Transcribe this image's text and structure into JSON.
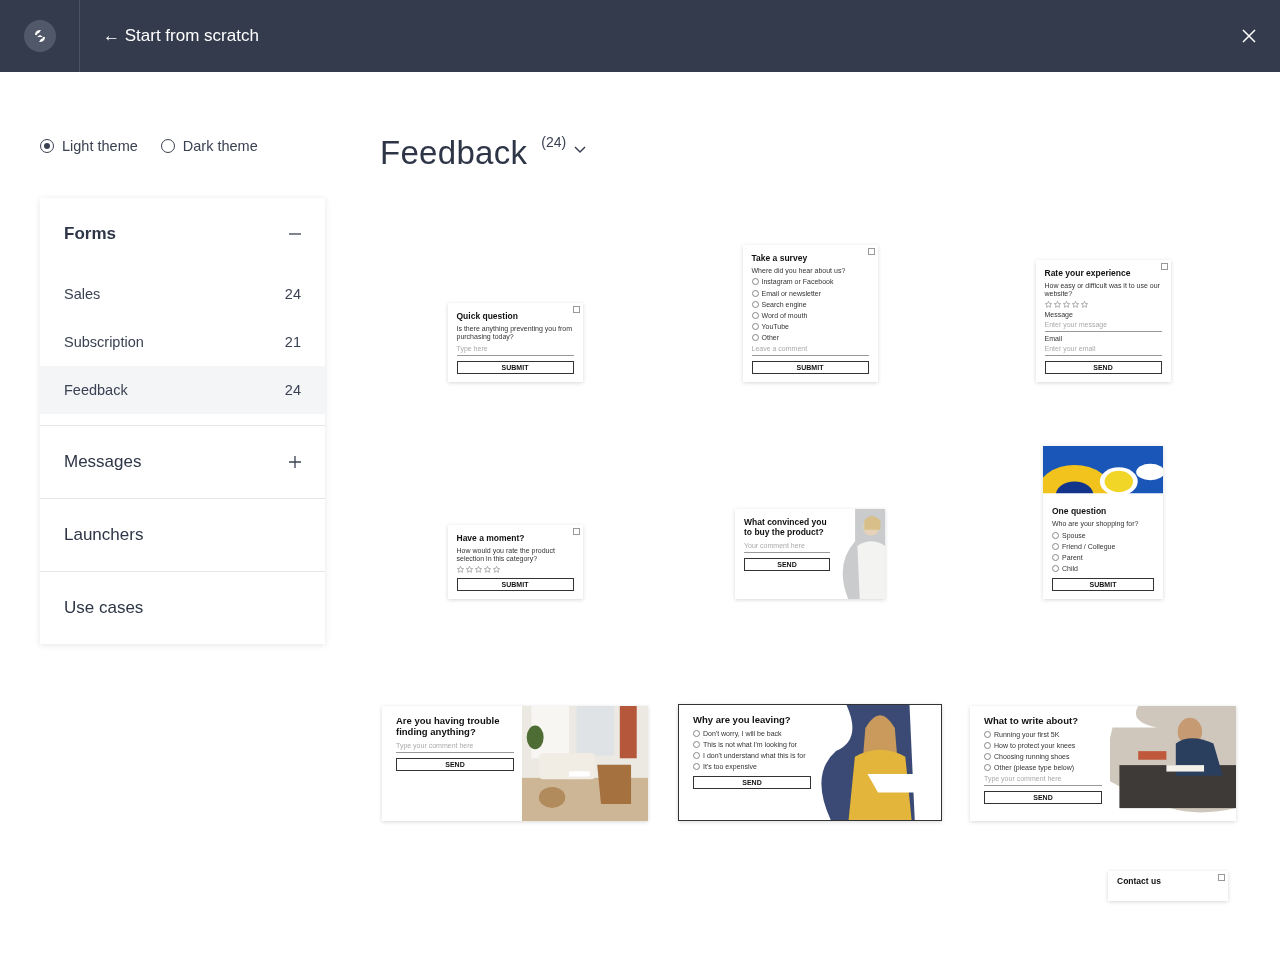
{
  "header": {
    "back_label": "← Start from scratch"
  },
  "themes": [
    {
      "label": "Light theme",
      "selected": true
    },
    {
      "label": "Dark theme",
      "selected": false
    }
  ],
  "sidebar": {
    "sections": [
      {
        "kind": "group",
        "title": "Forms",
        "expanded": true,
        "items": [
          {
            "label": "Sales",
            "count": "24",
            "selected": false
          },
          {
            "label": "Subscription",
            "count": "21",
            "selected": false
          },
          {
            "label": "Feedback",
            "count": "24",
            "selected": true
          }
        ]
      },
      {
        "kind": "group",
        "title": "Messages",
        "expanded": false
      },
      {
        "kind": "link",
        "title": "Launchers"
      },
      {
        "kind": "link",
        "title": "Use cases"
      }
    ]
  },
  "heading": {
    "title": "Feedback",
    "count": "(24)"
  },
  "templates": [
    {
      "kind": "plain",
      "blocks": [
        {
          "kind": "title",
          "text": "Quick question"
        },
        {
          "kind": "text",
          "text": "Is there anything preventing you from purchasing today?"
        },
        {
          "kind": "input",
          "placeholder": "Type here"
        },
        {
          "kind": "button",
          "text": "SUBMIT"
        }
      ]
    },
    {
      "kind": "plain",
      "blocks": [
        {
          "kind": "title",
          "text": "Take a survey"
        },
        {
          "kind": "text",
          "text": "Where did you hear about us?"
        },
        {
          "kind": "option",
          "text": "Instagram or Facebook"
        },
        {
          "kind": "option",
          "text": "Email or newsletter"
        },
        {
          "kind": "option",
          "text": "Search engine"
        },
        {
          "kind": "option",
          "text": "Word of mouth"
        },
        {
          "kind": "option",
          "text": "YouTube"
        },
        {
          "kind": "option",
          "text": "Other"
        },
        {
          "kind": "input",
          "placeholder": "Leave a comment"
        },
        {
          "kind": "button",
          "text": "SUBMIT"
        }
      ]
    },
    {
      "kind": "plain",
      "blocks": [
        {
          "kind": "title",
          "text": "Rate your experience"
        },
        {
          "kind": "text",
          "text": "How easy or difficult was it to use our website?"
        },
        {
          "kind": "rating",
          "stars": 0
        },
        {
          "kind": "label",
          "text": "Message"
        },
        {
          "kind": "input",
          "placeholder": "Enter your message"
        },
        {
          "kind": "label",
          "text": "Email"
        },
        {
          "kind": "input",
          "placeholder": "Enter your email"
        },
        {
          "kind": "button",
          "text": "SEND"
        }
      ]
    },
    {
      "kind": "plain",
      "blocks": [
        {
          "kind": "title",
          "text": "Have a moment?"
        },
        {
          "kind": "text",
          "text": "How would you rate the product selection in this category?"
        },
        {
          "kind": "rating",
          "stars": 0
        },
        {
          "kind": "button",
          "text": "SUBMIT"
        }
      ]
    },
    {
      "kind": "overlay",
      "blocks": [
        {
          "kind": "title",
          "text": "What convinced you to buy the product?"
        },
        {
          "kind": "input",
          "placeholder": "Your comment here"
        },
        {
          "kind": "button",
          "text": "SEND"
        }
      ]
    },
    {
      "kind": "banner",
      "blocks": [
        {
          "kind": "title",
          "text": "One question"
        },
        {
          "kind": "text",
          "text": "Who are your shopping for?"
        },
        {
          "kind": "option",
          "text": "Spouse"
        },
        {
          "kind": "option",
          "text": "Friend / Collegue"
        },
        {
          "kind": "option",
          "text": "Parent"
        },
        {
          "kind": "option",
          "text": "Child"
        },
        {
          "kind": "button",
          "text": "SUBMIT"
        }
      ]
    },
    {
      "kind": "side",
      "blocks": [
        {
          "kind": "title",
          "text": "Are you having trouble finding anything?"
        },
        {
          "kind": "input",
          "placeholder": "Type your comment here"
        },
        {
          "kind": "button",
          "text": "SEND"
        }
      ]
    },
    {
      "kind": "framed",
      "blocks": [
        {
          "kind": "title",
          "text": "Why are you leaving?"
        },
        {
          "kind": "option",
          "text": "Don't worry, I will be back"
        },
        {
          "kind": "option",
          "text": "This is not what I'm looking for"
        },
        {
          "kind": "option",
          "text": "I don't understand what this is for"
        },
        {
          "kind": "option",
          "text": "It's too expensive"
        },
        {
          "kind": "button",
          "text": "SEND"
        }
      ]
    },
    {
      "kind": "side",
      "blocks": [
        {
          "kind": "title",
          "text": "What to write about?"
        },
        {
          "kind": "option",
          "text": "Running your first 5K"
        },
        {
          "kind": "option",
          "text": "How to protect your knees"
        },
        {
          "kind": "option",
          "text": "Choosing running shoes"
        },
        {
          "kind": "option",
          "text": "Other (please type below)"
        },
        {
          "kind": "input",
          "placeholder": "Type your comment here"
        },
        {
          "kind": "button",
          "text": "SEND"
        }
      ]
    },
    {
      "kind": "peek",
      "blocks": [
        {
          "kind": "title",
          "text": "Contact us"
        }
      ]
    }
  ]
}
